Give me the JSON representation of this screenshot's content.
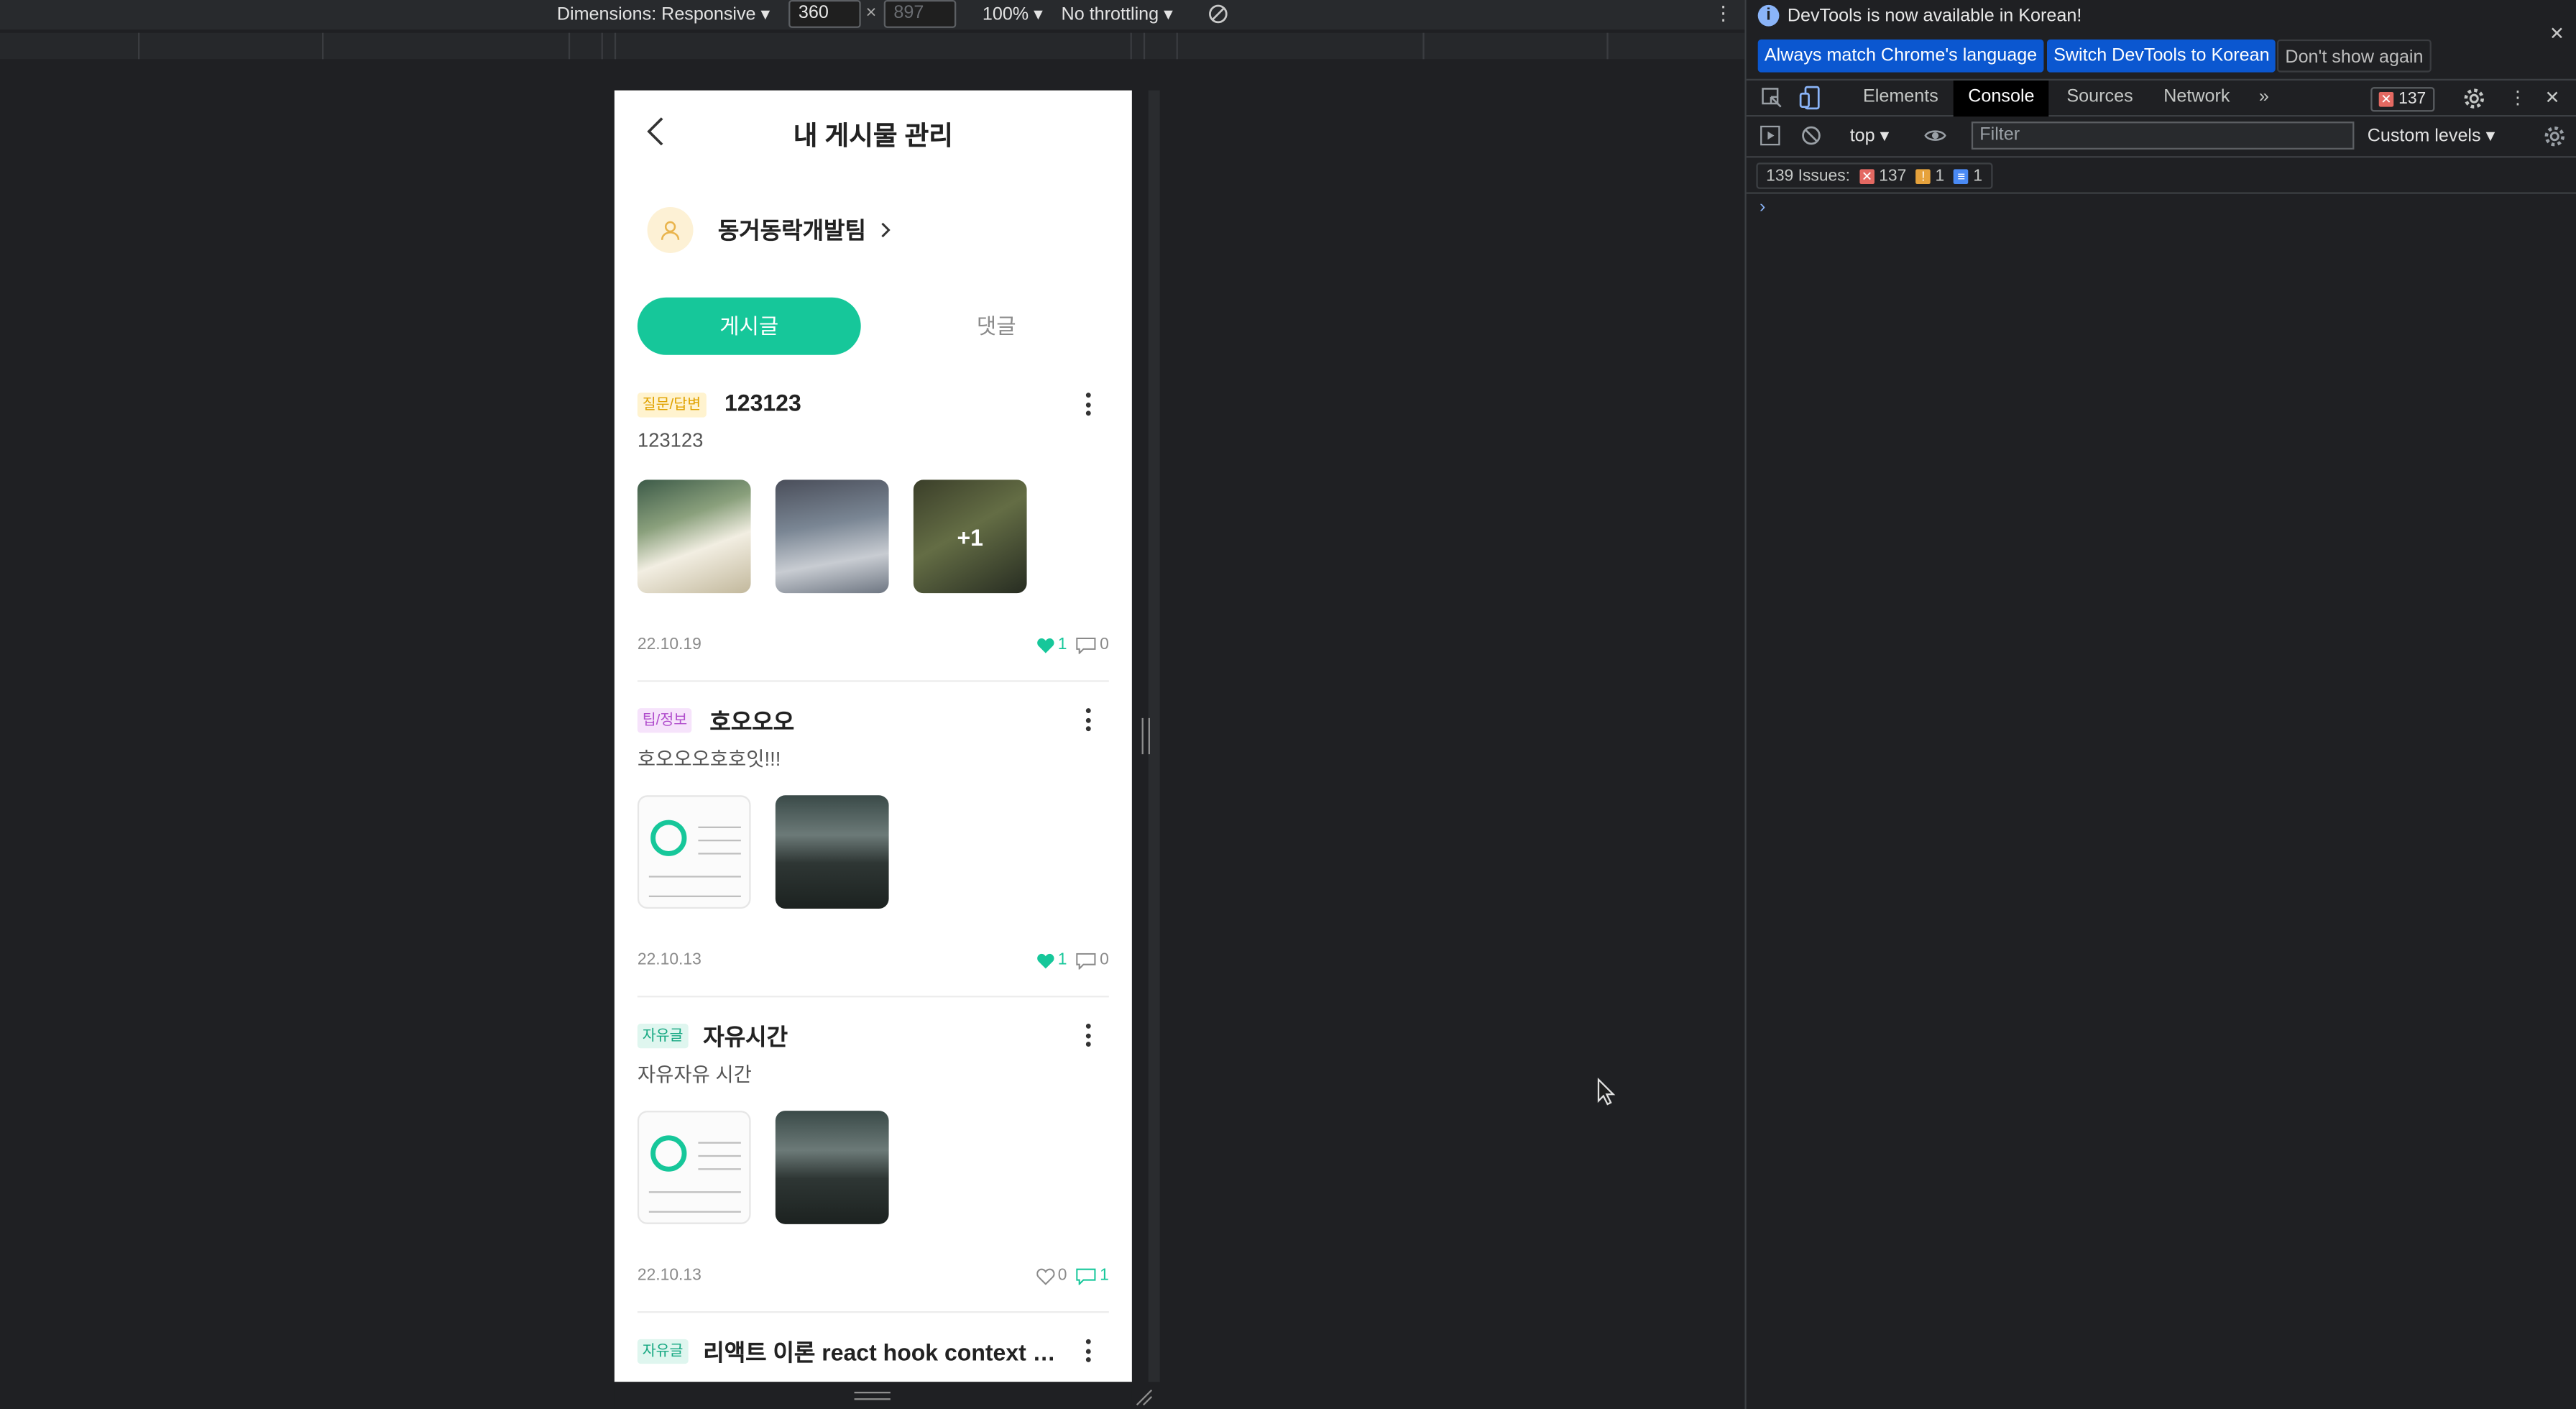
{
  "devtoolbar": {
    "dimensions_label": "Dimensions: Responsive",
    "width_value": "360",
    "height_value": "897",
    "zoom": "100%",
    "throttling": "No throttling"
  },
  "phone": {
    "title": "내 게시물 관리",
    "profile_name": "동거동락개발팀",
    "tabs": [
      "게시글",
      "댓글"
    ],
    "posts": [
      {
        "category": "질문/답변",
        "title": "123123",
        "body": "123123",
        "date": "22.10.19",
        "likes": "1",
        "comments": "0",
        "extra_images": "+1"
      },
      {
        "category": "팁/정보",
        "title": "호오오오",
        "body": "호오오오호호잇!!!",
        "date": "22.10.13",
        "likes": "1",
        "comments": "0"
      },
      {
        "category": "자유글",
        "title": "자유시간",
        "body": "자유자유 시간",
        "date": "22.10.13",
        "likes": "0",
        "comments": "1"
      },
      {
        "category": "자유글",
        "title": "리액트 이론 react hook context ap…"
      }
    ]
  },
  "devtools": {
    "info_text": "DevTools is now available in Korean!",
    "btn_match": "Always match Chrome's language",
    "btn_switch": "Switch DevTools to Korean",
    "btn_dont_show": "Don't show again",
    "tabs": [
      "Elements",
      "Console",
      "Sources",
      "Network"
    ],
    "error_count": "137",
    "context": "top",
    "filter_placeholder": "Filter",
    "levels": "Custom levels",
    "issues_label": "139 Issues:",
    "issues_errors": "137",
    "issues_warnings": "1",
    "issues_info": "1",
    "prompt": "›"
  },
  "colors": {
    "accent": "#16c79a",
    "devtools_bg": "#1f2023"
  }
}
